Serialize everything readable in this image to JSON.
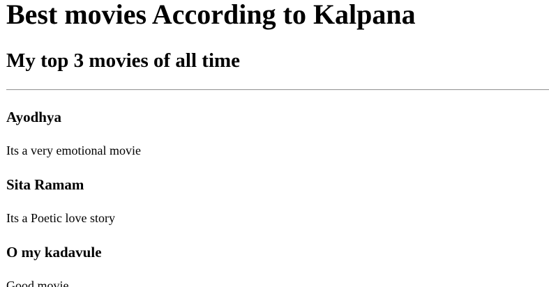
{
  "page": {
    "title": "Best movies According to Kalpana",
    "subtitle": "My top 3 movies of all time"
  },
  "movies": [
    {
      "title": "Ayodhya",
      "description": "Its a very emotional movie"
    },
    {
      "title": "Sita Ramam",
      "description": "Its a Poetic love story"
    },
    {
      "title": "O my kadavule",
      "description": "Good movie"
    }
  ]
}
